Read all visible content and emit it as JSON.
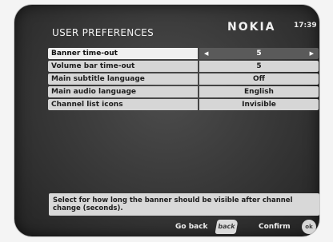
{
  "header": {
    "title": "USER PREFERENCES",
    "brand": "NOKIA",
    "time": "17:39"
  },
  "menu": {
    "items": [
      {
        "label": "Banner time-out",
        "value": "5",
        "selected": true
      },
      {
        "label": "Volume bar time-out",
        "value": "5",
        "selected": false
      },
      {
        "label": "Main subtitle language",
        "value": "Off",
        "selected": false
      },
      {
        "label": "Main audio language",
        "value": "English",
        "selected": false
      },
      {
        "label": "Channel list icons",
        "value": "Invisible",
        "selected": false
      }
    ],
    "arrow_left": "◀",
    "arrow_right": "▶"
  },
  "help": {
    "text": "Select for how long the banner should be visible after channel change (seconds)."
  },
  "footer": {
    "go_back_label": "Go back",
    "back_key": "back",
    "confirm_label": "Confirm",
    "ok_key": "ok"
  },
  "colors": {
    "screen_bg": "#363636",
    "row_bg": "#d6d6d6",
    "selected_value_bg": "#5a5a5a",
    "text_light": "#f2f2f2",
    "text_dark": "#1c1c1c"
  }
}
